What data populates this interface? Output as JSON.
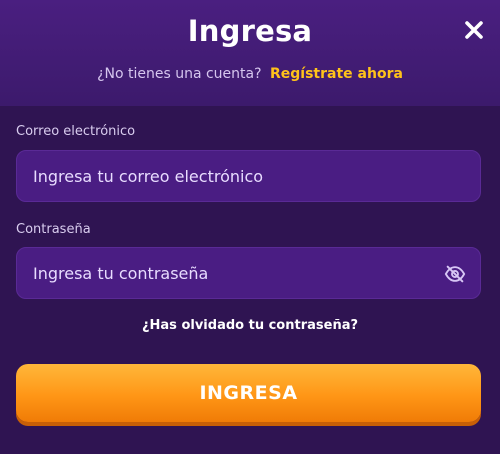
{
  "modal": {
    "title": "Ingresa",
    "close_icon": "close-icon",
    "signup_prompt": "¿No tienes una cuenta?",
    "signup_link": "Regístrate ahora"
  },
  "form": {
    "email_label": "Correo electrónico",
    "email_placeholder": "Ingresa tu correo electrónico",
    "email_value": "",
    "password_label": "Contraseña",
    "password_placeholder": "Ingresa tu contraseña",
    "password_value": "",
    "password_toggle_icon": "eye-off-icon",
    "forgot_link": "¿Has olvidado tu contraseña?",
    "submit_label": "INGRESA"
  },
  "colors": {
    "background": "#3a1a66",
    "field_bg": "#4a1d83",
    "link_accent": "#ffc21a",
    "button_orange": "#ff9616"
  }
}
